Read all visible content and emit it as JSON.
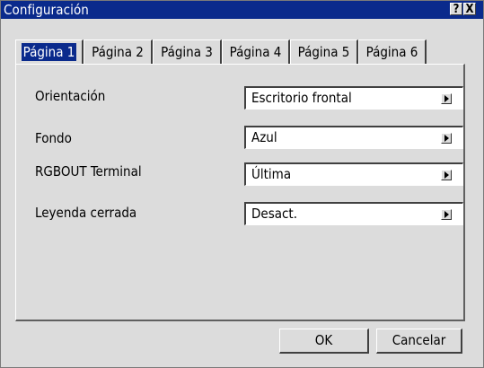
{
  "window": {
    "title": "Configuración",
    "help_label": "?",
    "close_label": "X"
  },
  "tabs": [
    {
      "label": "Página 1",
      "active": true
    },
    {
      "label": "Página 2",
      "active": false
    },
    {
      "label": "Página 3",
      "active": false
    },
    {
      "label": "Página 4",
      "active": false
    },
    {
      "label": "Página 5",
      "active": false
    },
    {
      "label": "Página 6",
      "active": false
    }
  ],
  "settings": [
    {
      "label": "Orientación",
      "value": "Escritorio frontal"
    },
    {
      "label": "Fondo",
      "value": "Azul"
    },
    {
      "label": "RGBOUT Terminal",
      "value": "Última"
    },
    {
      "label": "Leyenda cerrada",
      "value": "Desact."
    }
  ],
  "buttons": {
    "ok": "OK",
    "cancel": "Cancelar"
  },
  "colors": {
    "titlebar": "#0a2a8c",
    "face": "#dcdcdc"
  }
}
